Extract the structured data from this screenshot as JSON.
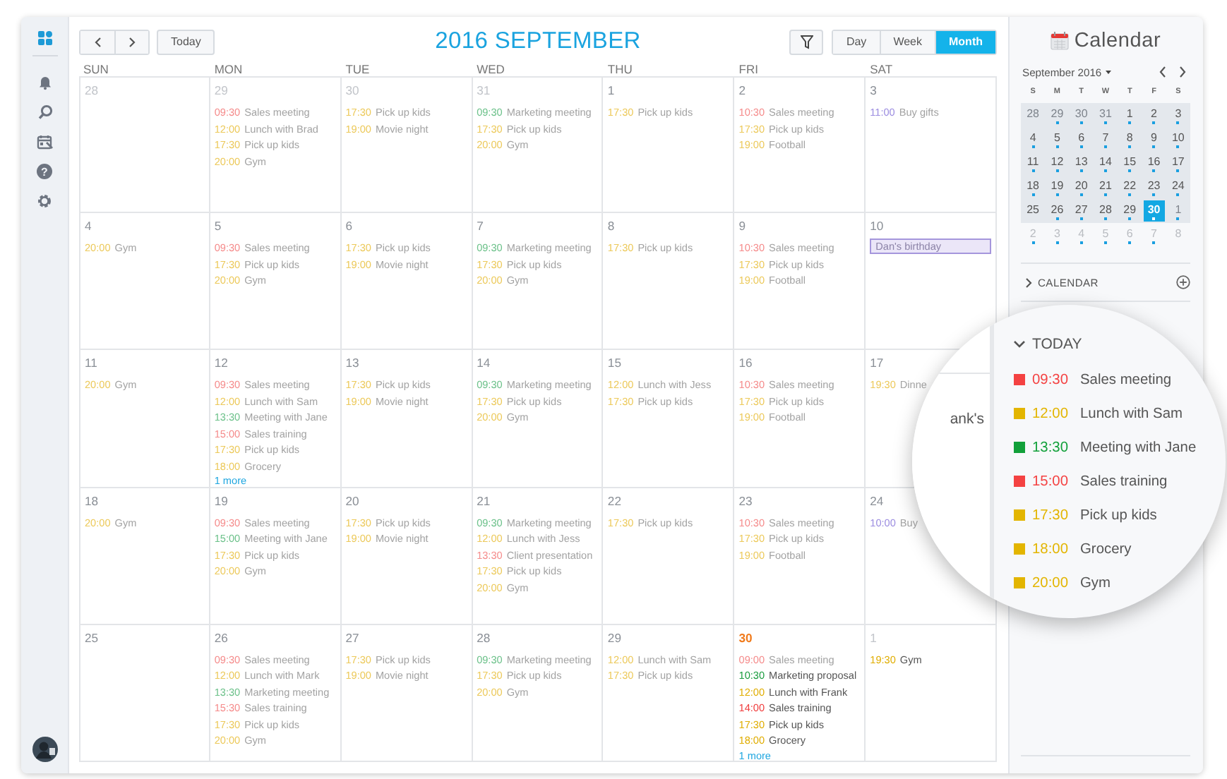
{
  "rail": {
    "avatar": true,
    "help_glyph": "?"
  },
  "toolbar": {
    "today_button": "Today",
    "title": "2016 SEPTEMBER",
    "views": [
      {
        "label": "Day",
        "selected": false
      },
      {
        "label": "Week",
        "selected": false
      },
      {
        "label": "Month",
        "selected": true
      }
    ]
  },
  "weekdays": [
    "SUN",
    "MON",
    "TUE",
    "WED",
    "THU",
    "FRI",
    "SAT"
  ],
  "weeks": [
    [
      {
        "date": "28",
        "other_month": true,
        "today": false
      },
      {
        "date": "29",
        "other_month": true,
        "today": false,
        "events": [
          {
            "time": "09:30",
            "title": "Sales meeting",
            "color": "#f58b8b",
            "past": true
          },
          {
            "time": "12:00",
            "title": "Lunch with Brad",
            "color": "#ecc95a",
            "past": true
          },
          {
            "time": "17:30",
            "title": "Pick up kids",
            "color": "#ecc95a",
            "past": true
          },
          {
            "time": "20:00",
            "title": "Gym",
            "color": "#ecc95a",
            "past": true
          }
        ]
      },
      {
        "date": "30",
        "other_month": true,
        "today": false,
        "events": [
          {
            "time": "17:30",
            "title": "Pick up kids",
            "color": "#ecc95a",
            "past": true
          },
          {
            "time": "19:00",
            "title": "Movie night",
            "color": "#ecc95a",
            "past": true
          }
        ]
      },
      {
        "date": "31",
        "other_month": true,
        "today": false,
        "events": [
          {
            "time": "09:30",
            "title": "Marketing meeting",
            "color": "#6cc18a",
            "past": true
          },
          {
            "time": "17:30",
            "title": "Pick up kids",
            "color": "#ecc95a",
            "past": true
          },
          {
            "time": "20:00",
            "title": "Gym",
            "color": "#ecc95a",
            "past": true
          }
        ]
      },
      {
        "date": "1",
        "other_month": false,
        "today": false,
        "events": [
          {
            "time": "17:30",
            "title": "Pick up kids",
            "color": "#ecc95a",
            "past": true
          }
        ]
      },
      {
        "date": "2",
        "other_month": false,
        "today": false,
        "events": [
          {
            "time": "10:30",
            "title": "Sales meeting",
            "color": "#f58b8b",
            "past": true
          },
          {
            "time": "17:30",
            "title": "Pick up kids",
            "color": "#ecc95a",
            "past": true
          },
          {
            "time": "19:00",
            "title": "Football",
            "color": "#ecc95a",
            "past": true
          }
        ]
      },
      {
        "date": "3",
        "other_month": false,
        "today": false,
        "events": [
          {
            "time": "11:00",
            "title": "Buy gifts",
            "color": "#9b8ce0",
            "past": true
          }
        ]
      }
    ],
    [
      {
        "date": "4",
        "other_month": false,
        "today": false,
        "events": [
          {
            "time": "20:00",
            "title": "Gym",
            "color": "#ecc95a",
            "past": true
          }
        ]
      },
      {
        "date": "5",
        "other_month": false,
        "today": false,
        "events": [
          {
            "time": "09:30",
            "title": "Sales meeting",
            "color": "#f58b8b",
            "past": true
          },
          {
            "time": "17:30",
            "title": "Pick up kids",
            "color": "#ecc95a",
            "past": true
          },
          {
            "time": "20:00",
            "title": "Gym",
            "color": "#ecc95a",
            "past": true
          }
        ]
      },
      {
        "date": "6",
        "other_month": false,
        "today": false,
        "events": [
          {
            "time": "17:30",
            "title": "Pick up kids",
            "color": "#ecc95a",
            "past": true
          },
          {
            "time": "19:00",
            "title": "Movie night",
            "color": "#ecc95a",
            "past": true
          }
        ]
      },
      {
        "date": "7",
        "other_month": false,
        "today": false,
        "events": [
          {
            "time": "09:30",
            "title": "Marketing meeting",
            "color": "#6cc18a",
            "past": true
          },
          {
            "time": "17:30",
            "title": "Pick up kids",
            "color": "#ecc95a",
            "past": true
          },
          {
            "time": "20:00",
            "title": "Gym",
            "color": "#ecc95a",
            "past": true
          }
        ]
      },
      {
        "date": "8",
        "other_month": false,
        "today": false,
        "events": [
          {
            "time": "17:30",
            "title": "Pick up kids",
            "color": "#ecc95a",
            "past": true
          }
        ]
      },
      {
        "date": "9",
        "other_month": false,
        "today": false,
        "events": [
          {
            "time": "10:30",
            "title": "Sales meeting",
            "color": "#f58b8b",
            "past": true
          },
          {
            "time": "17:30",
            "title": "Pick up kids",
            "color": "#ecc95a",
            "past": true
          },
          {
            "time": "19:00",
            "title": "Football",
            "color": "#ecc95a",
            "past": true
          }
        ]
      },
      {
        "date": "10",
        "other_month": false,
        "today": false,
        "all_day": [
          "Dan's birthday"
        ]
      }
    ],
    [
      {
        "date": "11",
        "other_month": false,
        "today": false,
        "events": [
          {
            "time": "20:00",
            "title": "Gym",
            "color": "#ecc95a",
            "past": true
          }
        ]
      },
      {
        "date": "12",
        "other_month": false,
        "today": false,
        "more": "1 more",
        "events": [
          {
            "time": "09:30",
            "title": "Sales meeting",
            "color": "#f58b8b",
            "past": true
          },
          {
            "time": "12:00",
            "title": "Lunch with Sam",
            "color": "#ecc95a",
            "past": true
          },
          {
            "time": "13:30",
            "title": "Meeting with Jane",
            "color": "#6cc18a",
            "past": true
          },
          {
            "time": "15:00",
            "title": "Sales training",
            "color": "#f58b8b",
            "past": true
          },
          {
            "time": "17:30",
            "title": "Pick up kids",
            "color": "#ecc95a",
            "past": true
          },
          {
            "time": "18:00",
            "title": "Grocery",
            "color": "#ecc95a",
            "past": true
          }
        ]
      },
      {
        "date": "13",
        "other_month": false,
        "today": false,
        "events": [
          {
            "time": "17:30",
            "title": "Pick up kids",
            "color": "#ecc95a",
            "past": true
          },
          {
            "time": "19:00",
            "title": "Movie night",
            "color": "#ecc95a",
            "past": true
          }
        ]
      },
      {
        "date": "14",
        "other_month": false,
        "today": false,
        "events": [
          {
            "time": "09:30",
            "title": "Marketing meeting",
            "color": "#6cc18a",
            "past": true
          },
          {
            "time": "17:30",
            "title": "Pick up kids",
            "color": "#ecc95a",
            "past": true
          },
          {
            "time": "20:00",
            "title": "Gym",
            "color": "#ecc95a",
            "past": true
          }
        ]
      },
      {
        "date": "15",
        "other_month": false,
        "today": false,
        "events": [
          {
            "time": "12:00",
            "title": "Lunch with Jess",
            "color": "#ecc95a",
            "past": true
          },
          {
            "time": "17:30",
            "title": "Pick up kids",
            "color": "#ecc95a",
            "past": true
          }
        ]
      },
      {
        "date": "16",
        "other_month": false,
        "today": false,
        "events": [
          {
            "time": "10:30",
            "title": "Sales meeting",
            "color": "#f58b8b",
            "past": true
          },
          {
            "time": "17:30",
            "title": "Pick up kids",
            "color": "#ecc95a",
            "past": true
          },
          {
            "time": "19:00",
            "title": "Football",
            "color": "#ecc95a",
            "past": true
          }
        ]
      },
      {
        "date": "17",
        "other_month": false,
        "today": false,
        "events": [
          {
            "time": "19:30",
            "title": "Dinne",
            "color": "#ecc95a",
            "past": true
          }
        ]
      }
    ],
    [
      {
        "date": "18",
        "other_month": false,
        "today": false,
        "events": [
          {
            "time": "20:00",
            "title": "Gym",
            "color": "#ecc95a",
            "past": true
          }
        ]
      },
      {
        "date": "19",
        "other_month": false,
        "today": false,
        "events": [
          {
            "time": "09:30",
            "title": "Sales meeting",
            "color": "#f58b8b",
            "past": true
          },
          {
            "time": "15:00",
            "title": "Meeting with Jane",
            "color": "#6cc18a",
            "past": true
          },
          {
            "time": "17:30",
            "title": "Pick up kids",
            "color": "#ecc95a",
            "past": true
          },
          {
            "time": "20:00",
            "title": "Gym",
            "color": "#ecc95a",
            "past": true
          }
        ]
      },
      {
        "date": "20",
        "other_month": false,
        "today": false,
        "events": [
          {
            "time": "17:30",
            "title": "Pick up kids",
            "color": "#ecc95a",
            "past": true
          },
          {
            "time": "19:00",
            "title": "Movie night",
            "color": "#ecc95a",
            "past": true
          }
        ]
      },
      {
        "date": "21",
        "other_month": false,
        "today": false,
        "events": [
          {
            "time": "09:30",
            "title": "Marketing meeting",
            "color": "#6cc18a",
            "past": true
          },
          {
            "time": "12:00",
            "title": "Lunch with Jess",
            "color": "#ecc95a",
            "past": true
          },
          {
            "time": "13:30",
            "title": "Client presentation",
            "color": "#f58b8b",
            "past": true
          },
          {
            "time": "17:30",
            "title": "Pick up kids",
            "color": "#ecc95a",
            "past": true
          },
          {
            "time": "20:00",
            "title": "Gym",
            "color": "#ecc95a",
            "past": true
          }
        ]
      },
      {
        "date": "22",
        "other_month": false,
        "today": false,
        "events": [
          {
            "time": "17:30",
            "title": "Pick up kids",
            "color": "#ecc95a",
            "past": true
          }
        ]
      },
      {
        "date": "23",
        "other_month": false,
        "today": false,
        "events": [
          {
            "time": "10:30",
            "title": "Sales meeting",
            "color": "#f58b8b",
            "past": true
          },
          {
            "time": "17:30",
            "title": "Pick up kids",
            "color": "#ecc95a",
            "past": true
          },
          {
            "time": "19:00",
            "title": "Football",
            "color": "#ecc95a",
            "past": true
          }
        ]
      },
      {
        "date": "24",
        "other_month": false,
        "today": false,
        "events": [
          {
            "time": "10:00",
            "title": "Buy",
            "color": "#9b8ce0",
            "past": true
          }
        ]
      }
    ],
    [
      {
        "date": "25",
        "other_month": false,
        "today": false
      },
      {
        "date": "26",
        "other_month": false,
        "today": false,
        "events": [
          {
            "time": "09:30",
            "title": "Sales meeting",
            "color": "#f58b8b",
            "past": true
          },
          {
            "time": "12:00",
            "title": "Lunch with Mark",
            "color": "#ecc95a",
            "past": true
          },
          {
            "time": "13:30",
            "title": "Marketing meeting",
            "color": "#6cc18a",
            "past": true
          },
          {
            "time": "15:30",
            "title": "Sales training",
            "color": "#f58b8b",
            "past": true
          },
          {
            "time": "17:30",
            "title": "Pick up kids",
            "color": "#ecc95a",
            "past": true
          },
          {
            "time": "20:00",
            "title": "Gym",
            "color": "#ecc95a",
            "past": true
          }
        ]
      },
      {
        "date": "27",
        "other_month": false,
        "today": false,
        "events": [
          {
            "time": "17:30",
            "title": "Pick up kids",
            "color": "#ecc95a",
            "past": true
          },
          {
            "time": "19:00",
            "title": "Movie night",
            "color": "#ecc95a",
            "past": true
          }
        ]
      },
      {
        "date": "28",
        "other_month": false,
        "today": false,
        "events": [
          {
            "time": "09:30",
            "title": "Marketing meeting",
            "color": "#6cc18a",
            "past": true
          },
          {
            "time": "17:30",
            "title": "Pick up kids",
            "color": "#ecc95a",
            "past": true
          },
          {
            "time": "20:00",
            "title": "Gym",
            "color": "#ecc95a",
            "past": true
          }
        ]
      },
      {
        "date": "29",
        "other_month": false,
        "today": false,
        "events": [
          {
            "time": "12:00",
            "title": "Lunch with Sam",
            "color": "#ecc95a",
            "past": true
          },
          {
            "time": "17:30",
            "title": "Pick up kids",
            "color": "#ecc95a",
            "past": true
          }
        ]
      },
      {
        "date": "30",
        "other_month": false,
        "today": true,
        "more": "1 more",
        "events": [
          {
            "time": "09:00",
            "title": "Sales meeting",
            "color": "#f58b8b",
            "past": true
          },
          {
            "time": "10:30",
            "title": "Marketing proposal",
            "color": "#1a9c3e",
            "past": false
          },
          {
            "time": "12:00",
            "title": "Lunch with Frank",
            "color": "#e0ad00",
            "past": false
          },
          {
            "time": "14:00",
            "title": "Sales training",
            "color": "#f03c3c",
            "past": false
          },
          {
            "time": "17:30",
            "title": "Pick up kids",
            "color": "#e0ad00",
            "past": false
          },
          {
            "time": "18:00",
            "title": "Grocery",
            "color": "#e0ad00",
            "past": false
          }
        ]
      },
      {
        "date": "1",
        "other_month": true,
        "today": false,
        "events": [
          {
            "time": "19:30",
            "title": "Gym",
            "color": "#e0ad00",
            "past": false
          }
        ]
      }
    ]
  ],
  "sidebar": {
    "title": "Calendar",
    "month": "September 2016",
    "weekdays": [
      "S",
      "M",
      "T",
      "W",
      "T",
      "F",
      "S"
    ],
    "mini_weeks": [
      {
        "in_view": true,
        "days": [
          {
            "n": "28",
            "other_month": true,
            "dot": false,
            "selected": false
          },
          {
            "n": "29",
            "other_month": true,
            "dot": true,
            "selected": false
          },
          {
            "n": "30",
            "other_month": true,
            "dot": true,
            "selected": false
          },
          {
            "n": "31",
            "other_month": true,
            "dot": true,
            "selected": false
          },
          {
            "n": "1",
            "other_month": false,
            "dot": true,
            "selected": false
          },
          {
            "n": "2",
            "other_month": false,
            "dot": true,
            "selected": false
          },
          {
            "n": "3",
            "other_month": false,
            "dot": true,
            "selected": false
          }
        ]
      },
      {
        "in_view": true,
        "days": [
          {
            "n": "4",
            "other_month": false,
            "dot": true,
            "selected": false
          },
          {
            "n": "5",
            "other_month": false,
            "dot": true,
            "selected": false
          },
          {
            "n": "6",
            "other_month": false,
            "dot": true,
            "selected": false
          },
          {
            "n": "7",
            "other_month": false,
            "dot": true,
            "selected": false
          },
          {
            "n": "8",
            "other_month": false,
            "dot": true,
            "selected": false
          },
          {
            "n": "9",
            "other_month": false,
            "dot": true,
            "selected": false
          },
          {
            "n": "10",
            "other_month": false,
            "dot": true,
            "selected": false
          }
        ]
      },
      {
        "in_view": true,
        "days": [
          {
            "n": "11",
            "other_month": false,
            "dot": true,
            "selected": false
          },
          {
            "n": "12",
            "other_month": false,
            "dot": true,
            "selected": false
          },
          {
            "n": "13",
            "other_month": false,
            "dot": true,
            "selected": false
          },
          {
            "n": "14",
            "other_month": false,
            "dot": true,
            "selected": false
          },
          {
            "n": "15",
            "other_month": false,
            "dot": true,
            "selected": false
          },
          {
            "n": "16",
            "other_month": false,
            "dot": true,
            "selected": false
          },
          {
            "n": "17",
            "other_month": false,
            "dot": true,
            "selected": false
          }
        ]
      },
      {
        "in_view": true,
        "days": [
          {
            "n": "18",
            "other_month": false,
            "dot": true,
            "selected": false
          },
          {
            "n": "19",
            "other_month": false,
            "dot": true,
            "selected": false
          },
          {
            "n": "20",
            "other_month": false,
            "dot": true,
            "selected": false
          },
          {
            "n": "21",
            "other_month": false,
            "dot": true,
            "selected": false
          },
          {
            "n": "22",
            "other_month": false,
            "dot": true,
            "selected": false
          },
          {
            "n": "23",
            "other_month": false,
            "dot": true,
            "selected": false
          },
          {
            "n": "24",
            "other_month": false,
            "dot": true,
            "selected": false
          }
        ]
      },
      {
        "in_view": true,
        "days": [
          {
            "n": "25",
            "other_month": false,
            "dot": false,
            "selected": false
          },
          {
            "n": "26",
            "other_month": false,
            "dot": true,
            "selected": false
          },
          {
            "n": "27",
            "other_month": false,
            "dot": true,
            "selected": false
          },
          {
            "n": "28",
            "other_month": false,
            "dot": true,
            "selected": false
          },
          {
            "n": "29",
            "other_month": false,
            "dot": true,
            "selected": false
          },
          {
            "n": "30",
            "other_month": false,
            "dot": true,
            "selected": true
          },
          {
            "n": "1",
            "other_month": true,
            "dot": true,
            "selected": false
          }
        ]
      },
      {
        "in_view": false,
        "days": [
          {
            "n": "2",
            "other_month": true,
            "dot": true,
            "selected": false
          },
          {
            "n": "3",
            "other_month": true,
            "dot": true,
            "selected": false
          },
          {
            "n": "4",
            "other_month": true,
            "dot": true,
            "selected": false
          },
          {
            "n": "5",
            "other_month": true,
            "dot": true,
            "selected": false
          },
          {
            "n": "6",
            "other_month": true,
            "dot": true,
            "selected": false
          },
          {
            "n": "7",
            "other_month": true,
            "dot": true,
            "selected": false
          },
          {
            "n": "8",
            "other_month": true,
            "dot": false,
            "selected": false
          }
        ]
      }
    ],
    "sections": [
      {
        "title": "CALENDAR",
        "expanded": false
      },
      {
        "title": "TODAY",
        "expanded": true,
        "items": [
          {
            "time": "09:30",
            "title": "Sales meeting",
            "color": "#f44242"
          },
          {
            "time": "12:00",
            "title": "Lunch with Sam",
            "color": "#e3b500"
          },
          {
            "time": "13:30",
            "title": "Meeting with Jane",
            "color": "#12a03a"
          },
          {
            "time": "15:00",
            "title": "Sales training",
            "color": "#f44242"
          },
          {
            "time": "17:30",
            "title": "Pick up kids",
            "color": "#e3b500"
          },
          {
            "time": "18:00",
            "title": "Grocery",
            "color": "#e3b500"
          },
          {
            "time": "20:00",
            "title": "Gym",
            "color": "#e3b500"
          }
        ]
      }
    ]
  },
  "magnifier": {
    "fragment": "ank's"
  }
}
